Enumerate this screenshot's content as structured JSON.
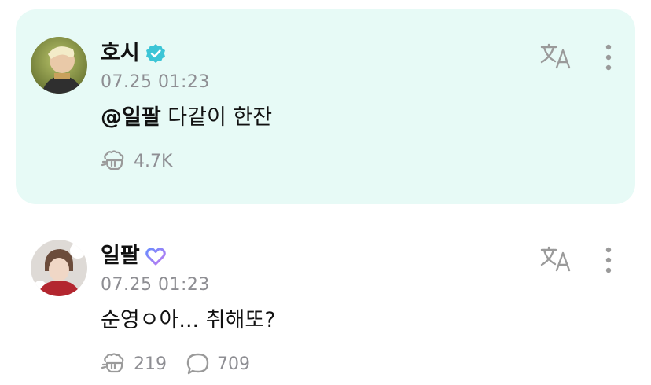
{
  "posts": [
    {
      "author": "호시",
      "badge": "verified-badge",
      "badge_color": "#3cc5d6",
      "time": "07.25 01:23",
      "mention": "@일팔",
      "text": " 다같이 한잔",
      "stats": [
        {
          "icon": "cheer-icon",
          "value": "4.7K"
        }
      ],
      "highlight_color": "#e7faf6"
    },
    {
      "author": "일팔",
      "badge": "heart-badge",
      "badge_color": "#9b7bf0",
      "time": "07.25 01:23",
      "text": "순영ㅇ아... 취해또?",
      "stats": [
        {
          "icon": "cheer-icon",
          "value": "219"
        },
        {
          "icon": "comment-icon",
          "value": "709"
        }
      ]
    }
  ],
  "colors": {
    "text_primary": "#111111",
    "text_secondary": "#8e8e93",
    "icon_gray": "#9a9a9a"
  }
}
